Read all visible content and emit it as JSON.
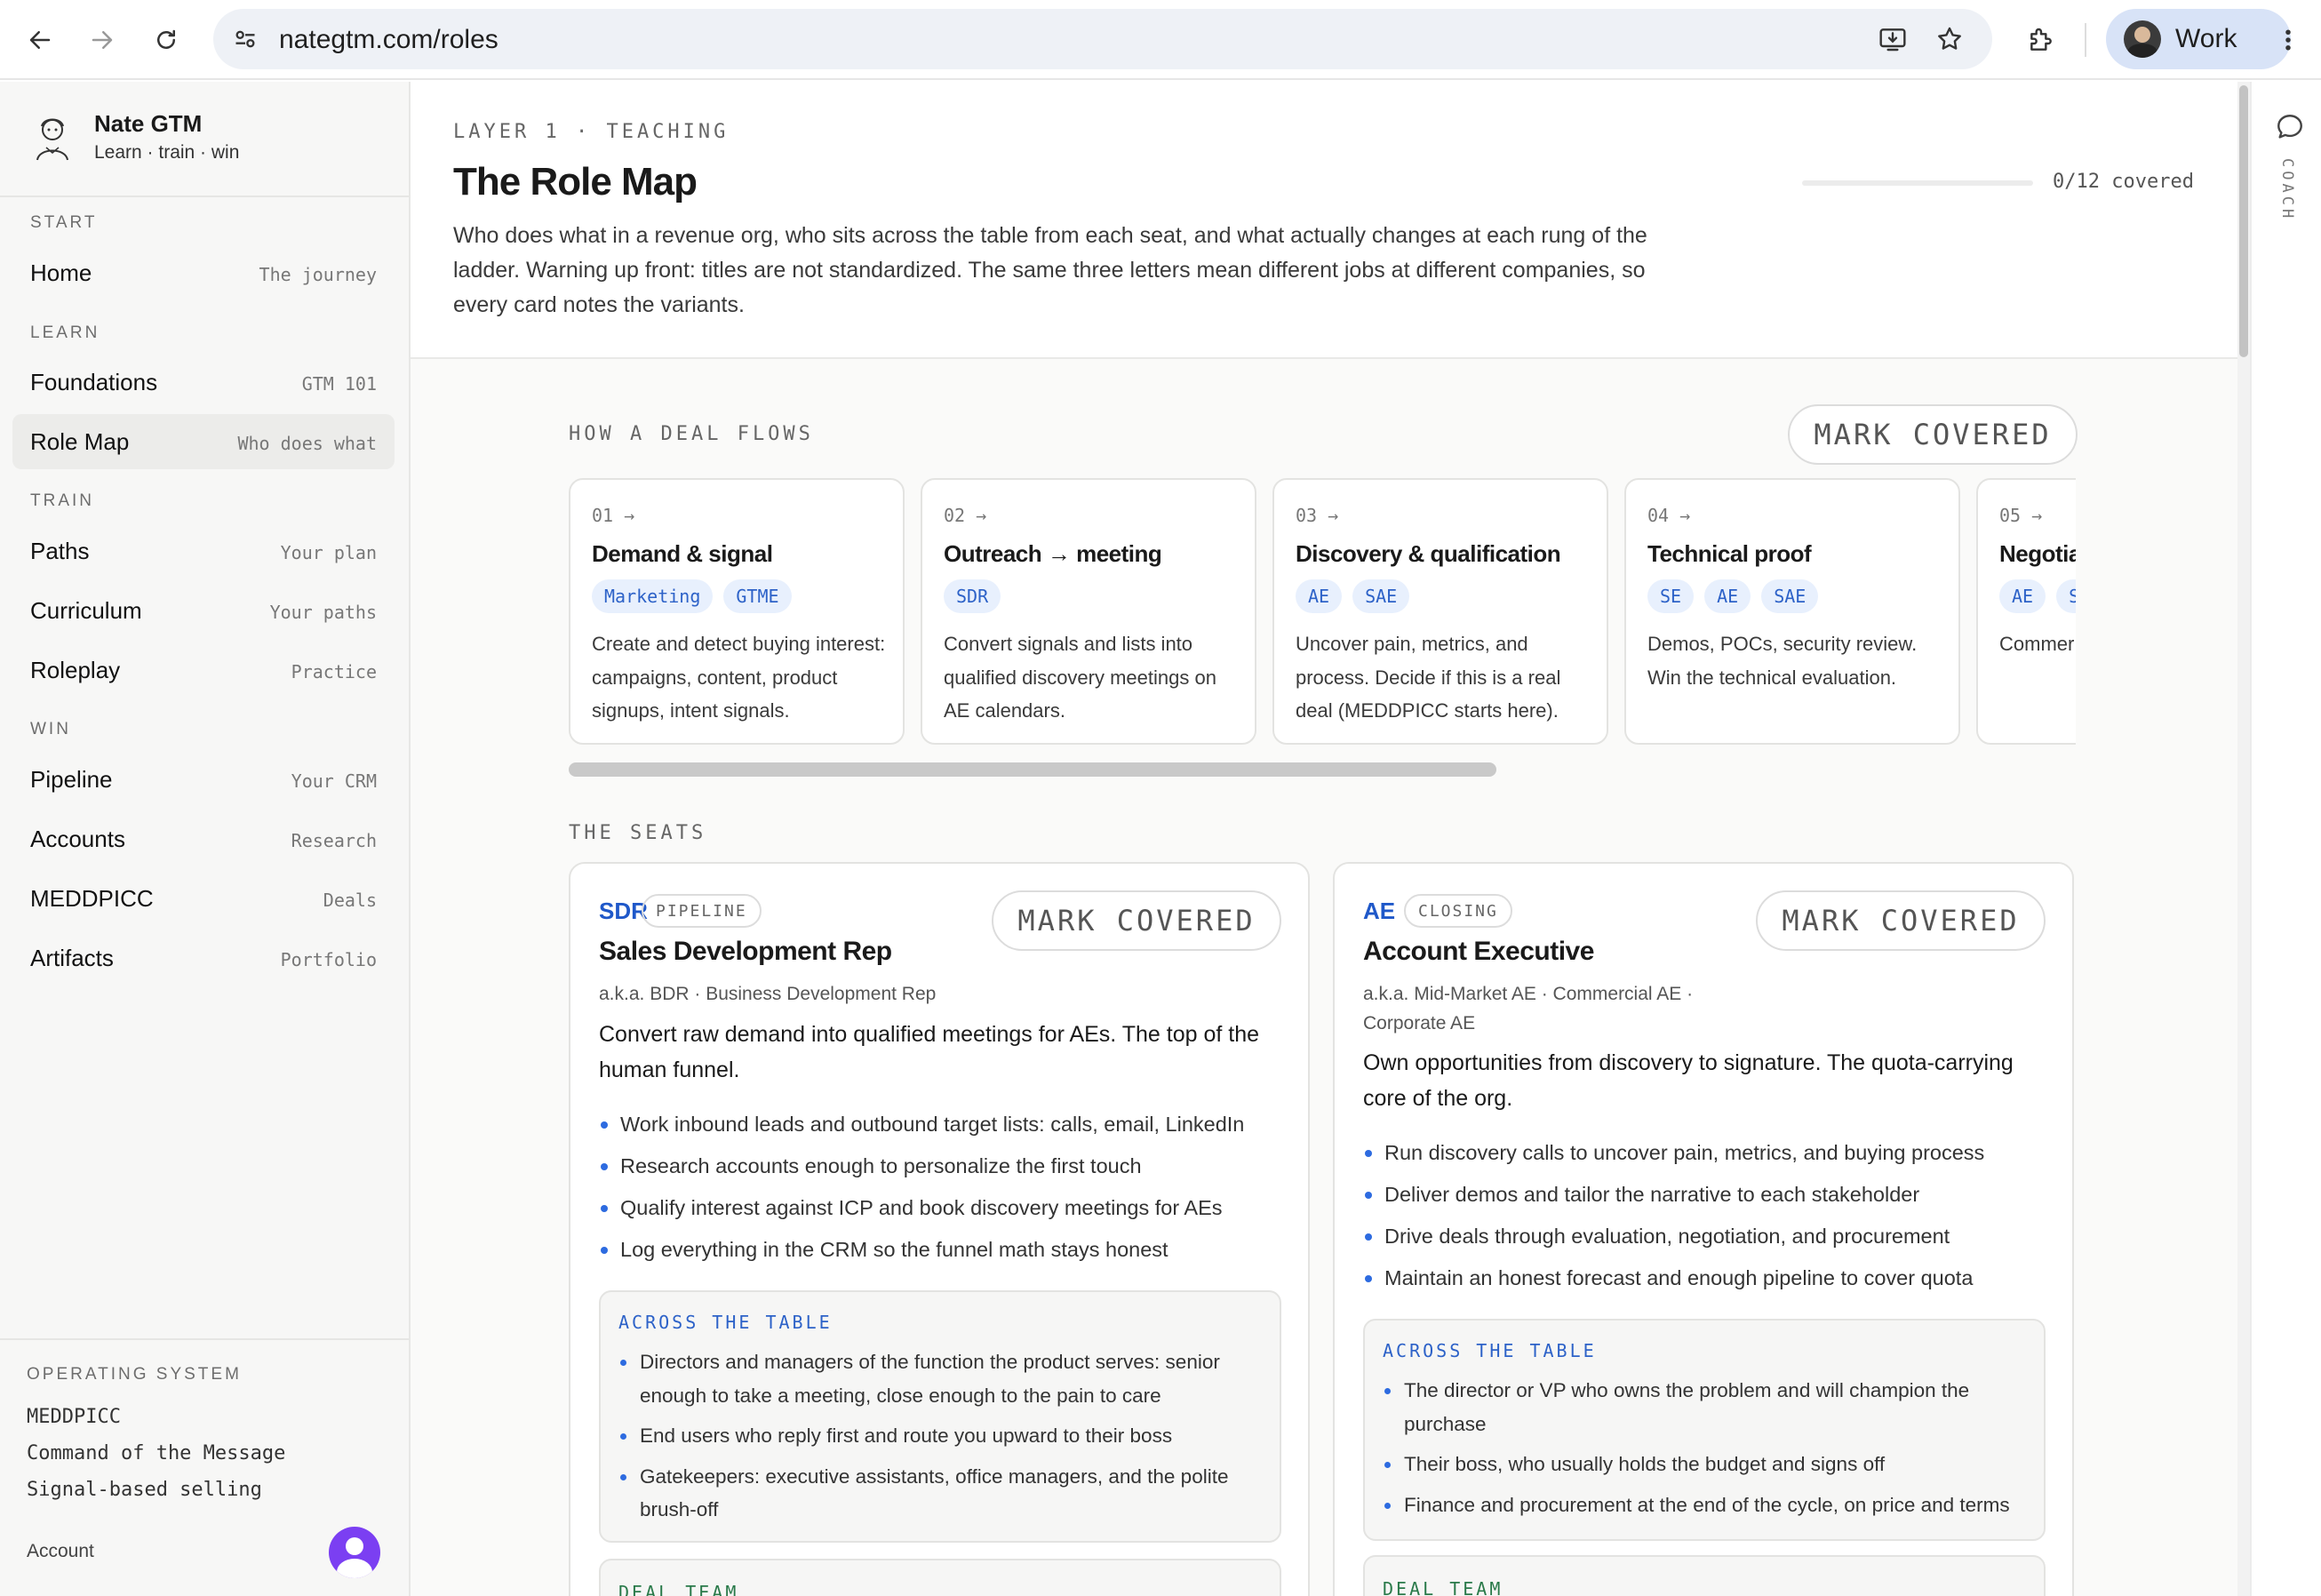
{
  "browser": {
    "url": "nategtm.com/roles",
    "profile_label": "Work"
  },
  "brand": {
    "name": "Nate GTM",
    "tagline": "Learn · train · win"
  },
  "sidebar": {
    "sections": [
      {
        "label": "START",
        "items": [
          {
            "label": "Home",
            "hint": "The journey"
          }
        ]
      },
      {
        "label": "LEARN",
        "items": [
          {
            "label": "Foundations",
            "hint": "GTM 101"
          },
          {
            "label": "Role Map",
            "hint": "Who does what",
            "active": true
          }
        ]
      },
      {
        "label": "TRAIN",
        "items": [
          {
            "label": "Paths",
            "hint": "Your plan"
          },
          {
            "label": "Curriculum",
            "hint": "Your paths"
          },
          {
            "label": "Roleplay",
            "hint": "Practice"
          }
        ]
      },
      {
        "label": "WIN",
        "items": [
          {
            "label": "Pipeline",
            "hint": "Your CRM"
          },
          {
            "label": "Accounts",
            "hint": "Research"
          },
          {
            "label": "MEDDPICC",
            "hint": "Deals"
          },
          {
            "label": "Artifacts",
            "hint": "Portfolio"
          }
        ]
      }
    ],
    "operating_system": {
      "heading": "OPERATING SYSTEM",
      "items": [
        "MEDDPICC",
        "Command of the Message",
        "Signal-based selling"
      ]
    },
    "account_label": "Account"
  },
  "page": {
    "eyebrow": "LAYER 1 · TEACHING",
    "title": "The Role Map",
    "lede": "Who does what in a revenue org, who sits across the table from each seat, and what actually changes at each rung of the ladder. Warning up front: titles are not standardized. The same three letters mean different jobs at different companies, so every card notes the variants.",
    "progress_text": "0/12 covered",
    "progress_fraction": 0
  },
  "flow": {
    "heading": "HOW A DEAL FLOWS",
    "mark_label": "MARK COVERED",
    "steps": [
      {
        "num": "01 →",
        "title": "Demand & signal",
        "chips": [
          "Marketing",
          "GTME"
        ],
        "desc": "Create and detect buying interest: campaigns, content, product signups, intent signals."
      },
      {
        "num": "02 →",
        "title": "Outreach → meeting",
        "chips": [
          "SDR"
        ],
        "desc": "Convert signals and lists into qualified discovery meetings on AE calendars."
      },
      {
        "num": "03 →",
        "title": "Discovery & qualification",
        "chips": [
          "AE",
          "SAE"
        ],
        "desc": "Uncover pain, metrics, and process. Decide if this is a real deal (MEDDPICC starts here)."
      },
      {
        "num": "04 →",
        "title": "Technical proof",
        "chips": [
          "SE",
          "AE",
          "SAE"
        ],
        "desc": "Demos, POCs, security review. Win the technical evaluation."
      },
      {
        "num": "05 →",
        "title": "Negotia",
        "chips": [
          "AE",
          "S"
        ],
        "desc": "Commer procurer the loop."
      }
    ]
  },
  "seats": {
    "heading": "THE SEATS",
    "mark_label": "MARK COVERED",
    "cards": [
      {
        "abbr": "SDR",
        "badge": "PIPELINE",
        "title": "Sales Development Rep",
        "aka": "a.k.a. BDR · Business Development Rep",
        "summary": "Convert raw demand into qualified meetings for AEs. The top of the human funnel.",
        "duties": [
          "Work inbound leads and outbound target lists: calls, email, LinkedIn",
          "Research accounts enough to personalize the first touch",
          "Qualify interest against ICP and book discovery meetings for AEs",
          "Log everything in the CRM so the funnel math stays honest"
        ],
        "across_heading": "ACROSS THE TABLE",
        "across": [
          "Directors and managers of the function the product serves: senior enough to take a meeting, close enough to the pain to care",
          "End users who reply first and route you upward to their boss",
          "Gatekeepers: executive assistants, office managers, and the polite brush-off"
        ],
        "deal_team_heading": "DEAL TEAM"
      },
      {
        "abbr": "AE",
        "badge": "CLOSING",
        "title": "Account Executive",
        "aka": "a.k.a. Mid-Market AE · Commercial AE · Corporate AE",
        "summary": "Own opportunities from discovery to signature. The quota-carrying core of the org.",
        "duties": [
          "Run discovery calls to uncover pain, metrics, and buying process",
          "Deliver demos and tailor the narrative to each stakeholder",
          "Drive deals through evaluation, negotiation, and procurement",
          "Maintain an honest forecast and enough pipeline to cover quota"
        ],
        "across_heading": "ACROSS THE TABLE",
        "across": [
          "The director or VP who owns the problem and will champion the purchase",
          "Their boss, who usually holds the budget and signs off",
          "Finance and procurement at the end of the cycle, on price and terms"
        ],
        "deal_team_heading": "DEAL TEAM"
      }
    ]
  },
  "rail": {
    "label": "COACH"
  },
  "icons": [
    "back-arrow-icon",
    "forward-arrow-icon",
    "reload-icon",
    "site-settings-icon",
    "install-app-icon",
    "bookmark-star-icon",
    "extensions-icon",
    "kebab-menu-icon",
    "chat-bubble-icon"
  ],
  "colors": {
    "accent": "#2d62c8",
    "chip_bg": "#e8f0fd",
    "active_nav": "#ececea"
  }
}
